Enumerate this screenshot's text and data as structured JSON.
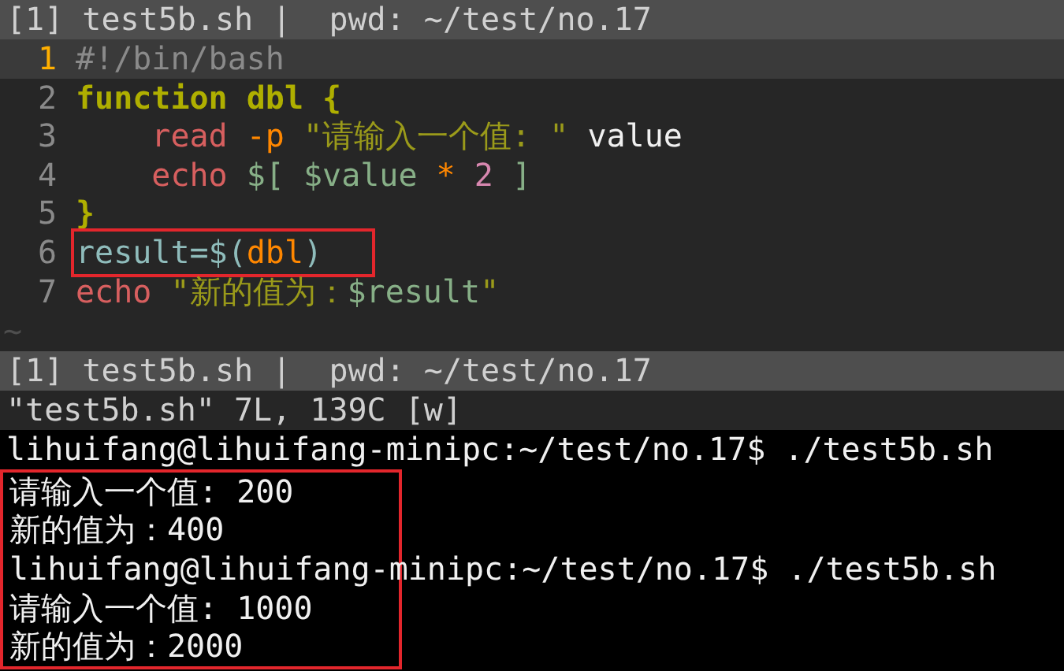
{
  "editor": {
    "title_bar": "[1] test5b.sh |  pwd: ~/test/no.17",
    "lines": [
      {
        "number": "1",
        "current": true,
        "boxed": false,
        "tokens": [
          {
            "kind": "comment",
            "text": "#!/bin/bash"
          }
        ]
      },
      {
        "number": "2",
        "current": false,
        "boxed": false,
        "tokens": [
          {
            "kind": "keyword",
            "text": "function dbl {"
          }
        ]
      },
      {
        "number": "3",
        "current": false,
        "boxed": false,
        "tokens": [
          {
            "kind": "builtin",
            "text": "    read "
          },
          {
            "kind": "option",
            "text": "-p "
          },
          {
            "kind": "string",
            "text": "\"请输入一个值: \""
          },
          {
            "kind": "plain",
            "text": " value"
          }
        ]
      },
      {
        "number": "4",
        "current": false,
        "boxed": false,
        "tokens": [
          {
            "kind": "builtin",
            "text": "    echo "
          },
          {
            "kind": "variable",
            "text": "$[ $value "
          },
          {
            "kind": "option",
            "text": "* "
          },
          {
            "kind": "number",
            "text": "2"
          },
          {
            "kind": "variable",
            "text": " ]"
          }
        ]
      },
      {
        "number": "5",
        "current": false,
        "boxed": false,
        "tokens": [
          {
            "kind": "keyword",
            "text": "}"
          }
        ]
      },
      {
        "number": "6",
        "current": false,
        "boxed": true,
        "tokens": [
          {
            "kind": "assign",
            "text": "result=$("
          },
          {
            "kind": "option",
            "text": "dbl"
          },
          {
            "kind": "assign",
            "text": ")"
          }
        ]
      },
      {
        "number": "7",
        "current": false,
        "boxed": false,
        "tokens": [
          {
            "kind": "builtin",
            "text": "echo "
          },
          {
            "kind": "string",
            "text": "\"新的值为："
          },
          {
            "kind": "variable",
            "text": "$result"
          },
          {
            "kind": "string",
            "text": "\""
          }
        ]
      }
    ],
    "tilde": "~"
  },
  "status": {
    "title_bar": "[1] test5b.sh |  pwd: ~/test/no.17",
    "message": "\"test5b.sh\" 7L, 139C [w]"
  },
  "terminal": {
    "lines": [
      {
        "boxed": false,
        "text": "lihuifang@lihuifang-minipc:~/test/no.17$ ./test5b.sh"
      },
      {
        "boxed": true,
        "text": "请输入一个值: 200"
      },
      {
        "boxed": true,
        "text": "新的值为：400"
      },
      {
        "boxed": true,
        "text": "lihuifang@lihuifang-minipc:~/test/no.17$ ./test5b.sh"
      },
      {
        "boxed": true,
        "text": "请输入一个值: 1000"
      },
      {
        "boxed": true,
        "text": "新的值为：2000"
      }
    ]
  }
}
